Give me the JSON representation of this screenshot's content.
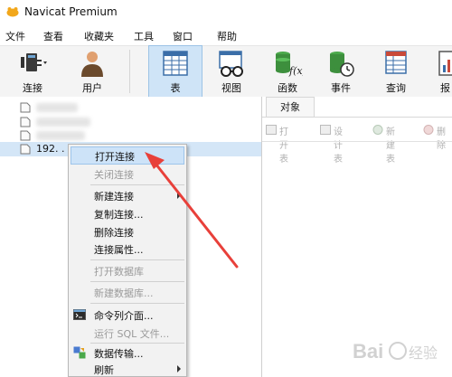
{
  "window": {
    "title": "Navicat Premium"
  },
  "menubar": {
    "items": [
      "文件",
      "查看",
      "收藏夹",
      "工具",
      "窗口",
      "帮助"
    ]
  },
  "toolbar": {
    "buttons": [
      {
        "label": "连接",
        "icon": "connection-plug-icon"
      },
      {
        "label": "用户",
        "icon": "user-icon"
      },
      {
        "label": "表",
        "icon": "table-grid-icon"
      },
      {
        "label": "视图",
        "icon": "view-glasses-icon"
      },
      {
        "label": "函数",
        "icon": "function-fx-icon"
      },
      {
        "label": "事件",
        "icon": "event-clock-icon"
      },
      {
        "label": "查询",
        "icon": "query-icon"
      },
      {
        "label": "报",
        "icon": "report-icon"
      }
    ],
    "active_button": "表"
  },
  "tree": {
    "selected_item_label": "192.  .  .101"
  },
  "object_panel": {
    "tab_label": "对象",
    "buttons": [
      {
        "label": "打开表"
      },
      {
        "label": "设计表"
      },
      {
        "label": "新建表"
      },
      {
        "label": "删除"
      }
    ]
  },
  "context_menu": {
    "items": [
      {
        "label": "打开连接",
        "state": "highlighted"
      },
      {
        "label": "关闭连接",
        "state": "disabled"
      },
      {
        "label": "新建连接",
        "submenu": true
      },
      {
        "label": "复制连接..."
      },
      {
        "label": "删除连接"
      },
      {
        "label": "连接属性..."
      },
      {
        "label": "打开数据库",
        "state": "disabled"
      },
      {
        "label": "新建数据库...",
        "state": "disabled"
      },
      {
        "label": "命令列介面...",
        "icon": "console-icon"
      },
      {
        "label": "运行 SQL 文件...",
        "state": "disabled"
      },
      {
        "label": "数据传输...",
        "icon": "data-transfer-icon"
      },
      {
        "label": "刷新",
        "submenu": true
      }
    ]
  },
  "colors": {
    "accent": "#cfe4f7",
    "annotation_arrow": "#e8403a",
    "highlight": "#cde3f8"
  },
  "watermark": "Bai 经验"
}
